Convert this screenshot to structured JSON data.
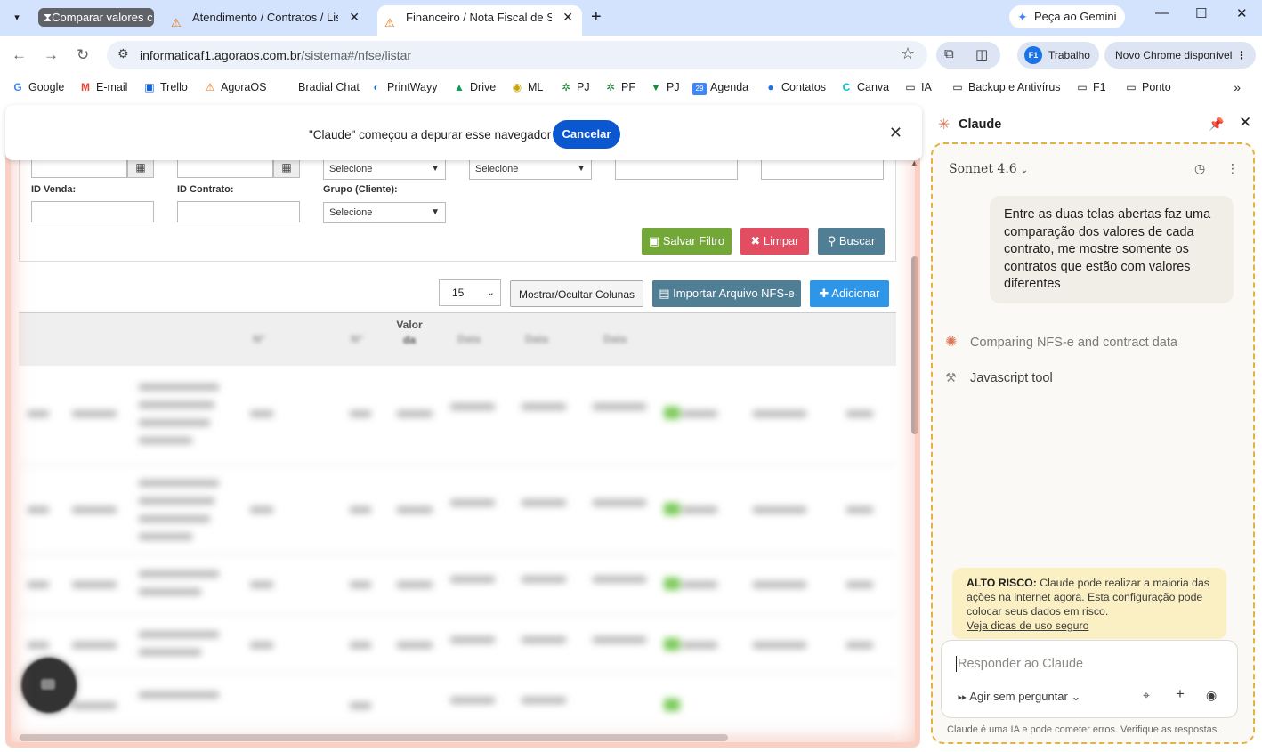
{
  "browser": {
    "tabs": [
      {
        "label": "Comparar valores c",
        "group": true
      },
      {
        "label": "Atendimento / Contratos / Lista",
        "close": "✕"
      },
      {
        "label": "Financeiro / Nota Fiscal de Serv",
        "close": "✕",
        "active": true
      }
    ],
    "gemini_label": "Peça ao Gemini",
    "url": {
      "host": "informaticaf1.agoraos.com.br",
      "path": "/sistema#/nfse/listar"
    },
    "profile_badge": "F1",
    "profile_label": "Trabalho",
    "update_label": "Novo Chrome disponível"
  },
  "bookmarks": [
    {
      "label": "Google",
      "icon": "G"
    },
    {
      "label": "E-mail",
      "icon": "M"
    },
    {
      "label": "Trello",
      "icon": "▣"
    },
    {
      "label": "AgoraOS",
      "icon": "⚠"
    },
    {
      "label": "Bradial Chat",
      "icon": ""
    },
    {
      "label": "PrintWayy",
      "icon": "◐"
    },
    {
      "label": "Drive",
      "icon": "▲"
    },
    {
      "label": "ML",
      "icon": "◉"
    },
    {
      "label": "PJ",
      "icon": "✲"
    },
    {
      "label": "PF",
      "icon": "✲"
    },
    {
      "label": "PJ",
      "icon": "▼"
    },
    {
      "label": "Agenda",
      "icon": "29"
    },
    {
      "label": "Contatos",
      "icon": "●"
    },
    {
      "label": "Canva",
      "icon": "C"
    },
    {
      "label": "IA",
      "icon": "▭"
    },
    {
      "label": "Backup e Antivírus",
      "icon": "▭"
    },
    {
      "label": "F1",
      "icon": "▭"
    },
    {
      "label": "Ponto",
      "icon": "▭"
    }
  ],
  "debug_banner": {
    "message": "\"Claude\" começou a depurar esse navegador",
    "cancel_label": "Cancelar"
  },
  "filter": {
    "select_placeholder": "Selecione",
    "labels": {
      "id_venda": "ID Venda:",
      "id_contrato": "ID Contrato:",
      "grupo": "Grupo (Cliente):"
    },
    "buttons": {
      "save": "Salvar Filtro",
      "clear": "Limpar",
      "search": "Buscar"
    }
  },
  "list_controls": {
    "page_size": "15",
    "toggle_columns": "Mostrar/Ocultar Colunas",
    "import": "Importar Arquivo NFS-e",
    "add": "Adicionar"
  },
  "table": {
    "visible_header": [
      "Valor",
      "da"
    ],
    "blurred_headers": [
      "N°",
      "N°",
      "Data",
      "Data",
      "Data"
    ]
  },
  "claude_panel": {
    "title": "Claude",
    "model": "Sonnet 4.6",
    "user_message": "Entre as duas telas abertas faz uma comparação dos valores de cada contrato, me mostre somente os contratos que estão com valores diferentes",
    "steps": [
      {
        "label": "Comparing NFS-e and contract data",
        "icon": "claude-burst-icon"
      },
      {
        "label": "Javascript tool",
        "icon": "wrench-icon"
      }
    ],
    "warning": {
      "title": "ALTO RISCO:",
      "text": "Claude pode realizar a maioria das ações na internet agora. Esta configuração pode colocar seus dados em risco.",
      "link": "Veja dicas de uso seguro"
    },
    "composer_placeholder": "Responder ao Claude",
    "mode_label": "Agir sem perguntar",
    "disclaimer": "Claude é uma IA e pode cometer erros. Verifique as respostas."
  }
}
